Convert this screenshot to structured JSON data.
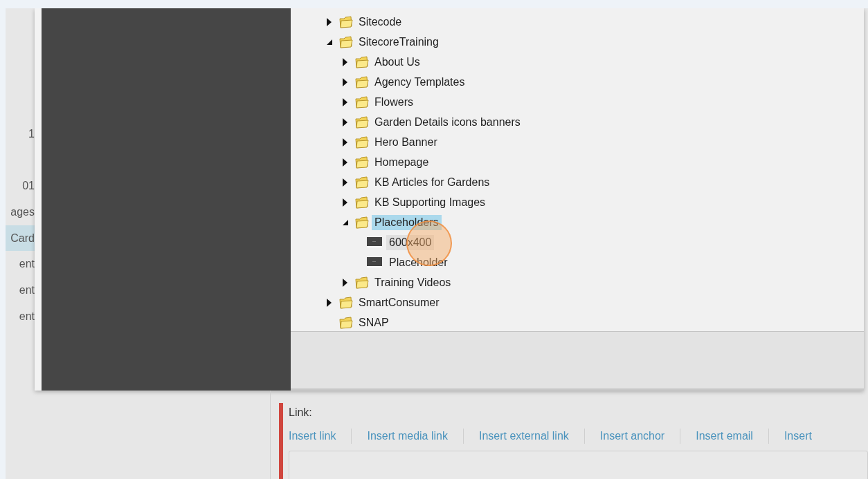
{
  "background_list": [
    {
      "text": "1",
      "selected": false
    },
    {
      "text": "01",
      "selected": false
    },
    {
      "text": "ages",
      "selected": false
    },
    {
      "text": "Card",
      "selected": true
    },
    {
      "text": "ent",
      "selected": false
    },
    {
      "text": "ent",
      "selected": false
    },
    {
      "text": "ent",
      "selected": false
    }
  ],
  "tree": [
    {
      "label": "Sitecode",
      "kind": "folder",
      "expandable": true,
      "expanded": false,
      "selected": false,
      "hovered": false
    },
    {
      "label": "SitecoreTraining",
      "kind": "folder",
      "expandable": true,
      "expanded": true,
      "selected": false,
      "hovered": false,
      "children": [
        {
          "label": "About Us",
          "kind": "folder",
          "expandable": true,
          "expanded": false,
          "selected": false,
          "hovered": false
        },
        {
          "label": "Agency Templates",
          "kind": "folder",
          "expandable": true,
          "expanded": false,
          "selected": false,
          "hovered": false
        },
        {
          "label": "Flowers",
          "kind": "folder",
          "expandable": true,
          "expanded": false,
          "selected": false,
          "hovered": false
        },
        {
          "label": "Garden Details icons banners",
          "kind": "folder",
          "expandable": true,
          "expanded": false,
          "selected": false,
          "hovered": false
        },
        {
          "label": "Hero Banner",
          "kind": "folder",
          "expandable": true,
          "expanded": false,
          "selected": false,
          "hovered": false
        },
        {
          "label": "Homepage",
          "kind": "folder",
          "expandable": true,
          "expanded": false,
          "selected": false,
          "hovered": false
        },
        {
          "label": "KB Articles for Gardens",
          "kind": "folder",
          "expandable": true,
          "expanded": false,
          "selected": false,
          "hovered": false
        },
        {
          "label": "KB Supporting Images",
          "kind": "folder",
          "expandable": true,
          "expanded": false,
          "selected": false,
          "hovered": false
        },
        {
          "label": "Placeholders",
          "kind": "folder",
          "expandable": true,
          "expanded": true,
          "selected": true,
          "hovered": false,
          "children": [
            {
              "label": "600x400",
              "kind": "item",
              "selected": false,
              "hovered": true
            },
            {
              "label": "Placeholder",
              "kind": "item",
              "selected": false,
              "hovered": false
            }
          ]
        },
        {
          "label": "Training Videos",
          "kind": "folder",
          "expandable": true,
          "expanded": false,
          "selected": false,
          "hovered": false
        }
      ]
    },
    {
      "label": "SmartConsumer",
      "kind": "folder",
      "expandable": true,
      "expanded": false,
      "selected": false,
      "hovered": false
    },
    {
      "label": "SNAP",
      "kind": "folder",
      "expandable": false,
      "selected": false,
      "hovered": false
    }
  ],
  "link_field": {
    "label": "Link:",
    "actions": [
      "Insert link",
      "Insert media link",
      "Insert external link",
      "Insert anchor",
      "Insert email",
      "Insert"
    ]
  }
}
